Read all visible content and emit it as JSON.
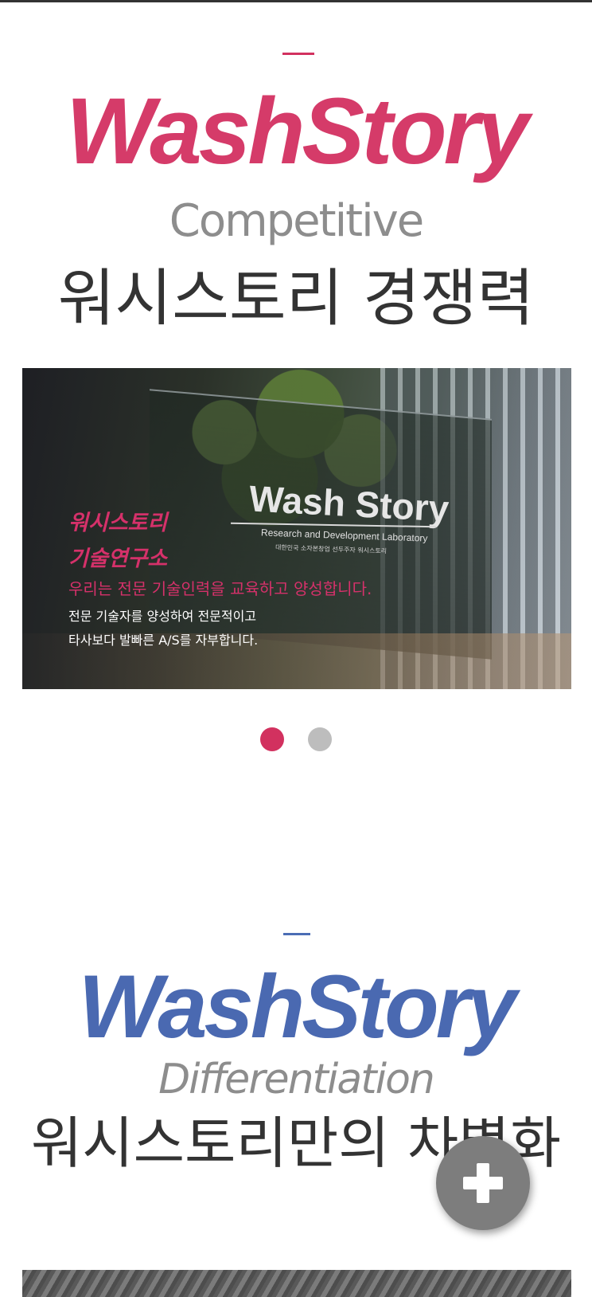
{
  "competitive": {
    "brand": "WashStory",
    "subtitle": "Competitive",
    "title": "워시스토리 경쟁력"
  },
  "slider": {
    "slide": {
      "sign_title": "Wash Story",
      "sign_subtitle": "Research and Development Laboratory",
      "sign_caption": "대한민국 소자본창업 선두주자 워시스토리",
      "title_line1": "워시스토리",
      "title_line2": "기술연구소",
      "highlight": "우리는 전문 기술인력을 교육하고 양성합니다.",
      "desc_line1": "전문 기술자를 양성하여 전문적이고",
      "desc_line2": "타사보다 발빠른 A/S를 자부합니다."
    },
    "dots": {
      "count": 2,
      "active_index": 0
    }
  },
  "differentiation": {
    "brand": "WashStory",
    "subtitle": "Differentiation",
    "title": "워시스토리만의 차별화"
  },
  "fab": {
    "icon": "plus-icon"
  },
  "colors": {
    "pink_accent": "#d2315f",
    "blue_accent": "#4a69b1",
    "dot_inactive": "#bdbdbd",
    "fab": "#7d7d7d"
  }
}
